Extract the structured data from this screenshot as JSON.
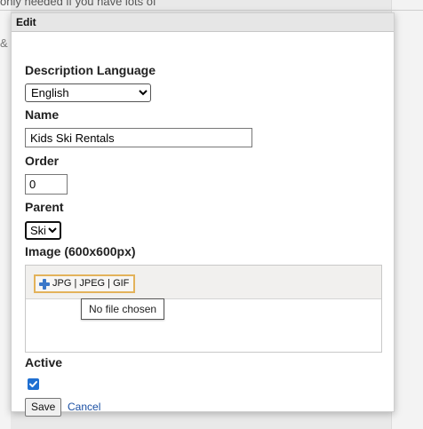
{
  "background": {
    "text_top": "only needed if you have lots of",
    "text_frag": "& S"
  },
  "dialog": {
    "title": "Edit",
    "fields": {
      "description_language": {
        "label": "Description Language",
        "value": "English",
        "options": [
          "English"
        ]
      },
      "name": {
        "label": "Name",
        "value": "Kids Ski Rentals"
      },
      "order": {
        "label": "Order",
        "value": "0"
      },
      "parent": {
        "label": "Parent",
        "value": "Ski",
        "options": [
          "Ski"
        ]
      },
      "image": {
        "label": "Image (600x600px)",
        "upload_button_label": "JPG | JPEG | GIF",
        "upload_icon": "plus-icon",
        "tooltip": "No file chosen"
      },
      "active": {
        "label": "Active",
        "checked": true
      }
    },
    "actions": {
      "save_label": "Save",
      "cancel_label": "Cancel"
    }
  },
  "colors": {
    "accent_checkbox": "#1f6fd1",
    "link": "#1a4fa3",
    "upload_border": "#e3b25a",
    "plus_icon": "#3b78c8"
  }
}
